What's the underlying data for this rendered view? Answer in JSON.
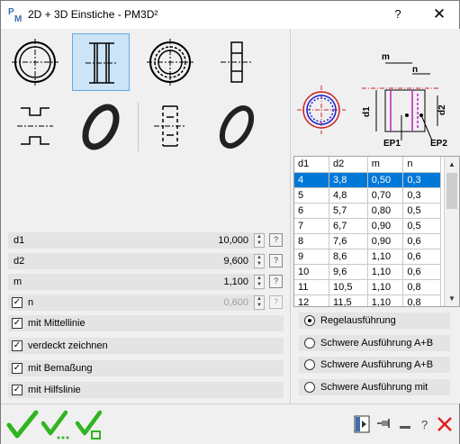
{
  "window": {
    "title": "2D + 3D Einstiche  -  PM3D²",
    "app_icon": "pm-logo-icon",
    "help_label": "?",
    "close_label": "✕"
  },
  "tools": [
    {
      "name": "tool-ring-front-view",
      "icon": "ring-front-view-icon",
      "selected": false
    },
    {
      "name": "tool-groove-section",
      "icon": "groove-section-icon",
      "selected": true
    },
    {
      "name": "tool-ring-dashed-view",
      "icon": "ring-dashed-view-icon",
      "selected": false
    },
    {
      "name": "tool-ring-side-view",
      "icon": "ring-side-view-icon",
      "selected": false
    },
    {
      "name": "tool-groove-profile",
      "icon": "groove-profile-icon",
      "selected": false
    },
    {
      "name": "tool-ring-3d",
      "icon": "ring-3d-icon",
      "selected": false
    },
    {
      "name": "tool-groove-hidden",
      "icon": "groove-hidden-icon",
      "selected": false
    },
    {
      "name": "tool-ring-3d-alt",
      "icon": "ring-3d-alt-icon",
      "selected": false
    }
  ],
  "fields": {
    "d1": {
      "label": "d1",
      "value": "10,000"
    },
    "d2": {
      "label": "d2",
      "value": "9,600"
    },
    "m": {
      "label": "m",
      "value": "1,100"
    },
    "n": {
      "label": "n",
      "value": "0,600",
      "checked": true,
      "disabled": true
    }
  },
  "options": {
    "mittellinie": {
      "label": "mit Mittellinie",
      "checked": true
    },
    "verdeckt": {
      "label": "verdeckt zeichnen",
      "checked": true
    },
    "bemassung": {
      "label": "mit Bemaßung",
      "checked": true
    },
    "hilfslinie": {
      "label": "mit Hilfslinie",
      "checked": true
    }
  },
  "preview": {
    "labels": {
      "m": "m",
      "n": "n",
      "d1": "d1",
      "d2": "d2",
      "ep1": "EP1",
      "ep2": "EP2"
    }
  },
  "table": {
    "headers": [
      "d1",
      "d2",
      "m",
      "n"
    ],
    "rows": [
      [
        "4",
        "3,8",
        "0,50",
        "0,3"
      ],
      [
        "5",
        "4,8",
        "0,70",
        "0,3"
      ],
      [
        "6",
        "5,7",
        "0,80",
        "0,5"
      ],
      [
        "7",
        "6,7",
        "0,90",
        "0,5"
      ],
      [
        "8",
        "7,6",
        "0,90",
        "0,6"
      ],
      [
        "9",
        "8,6",
        "1,10",
        "0,6"
      ],
      [
        "10",
        "9,6",
        "1,10",
        "0,6"
      ],
      [
        "11",
        "10,5",
        "1,10",
        "0,8"
      ],
      [
        "12",
        "11,5",
        "1,10",
        "0,8"
      ]
    ],
    "selected_row": 0
  },
  "variants": [
    {
      "label": "Regelausführung",
      "selected": true
    },
    {
      "label": "Schwere Ausführung A+B",
      "selected": false
    },
    {
      "label": "Schwere Ausführung A+B",
      "selected": false
    },
    {
      "label": "Schwere Ausführung mit",
      "selected": false
    }
  ],
  "footer": {
    "ok_icons": [
      "checkmark-icon",
      "checkmark-repeat-icon",
      "checkmark-box-icon"
    ],
    "tool_icons": [
      "pin-panel-icon",
      "pushpin-icon",
      "minimize-icon",
      "help-icon",
      "cancel-icon"
    ],
    "accent_green": "#2fb520",
    "cancel_red": "#e02020",
    "selection_blue": "#0078d7"
  }
}
